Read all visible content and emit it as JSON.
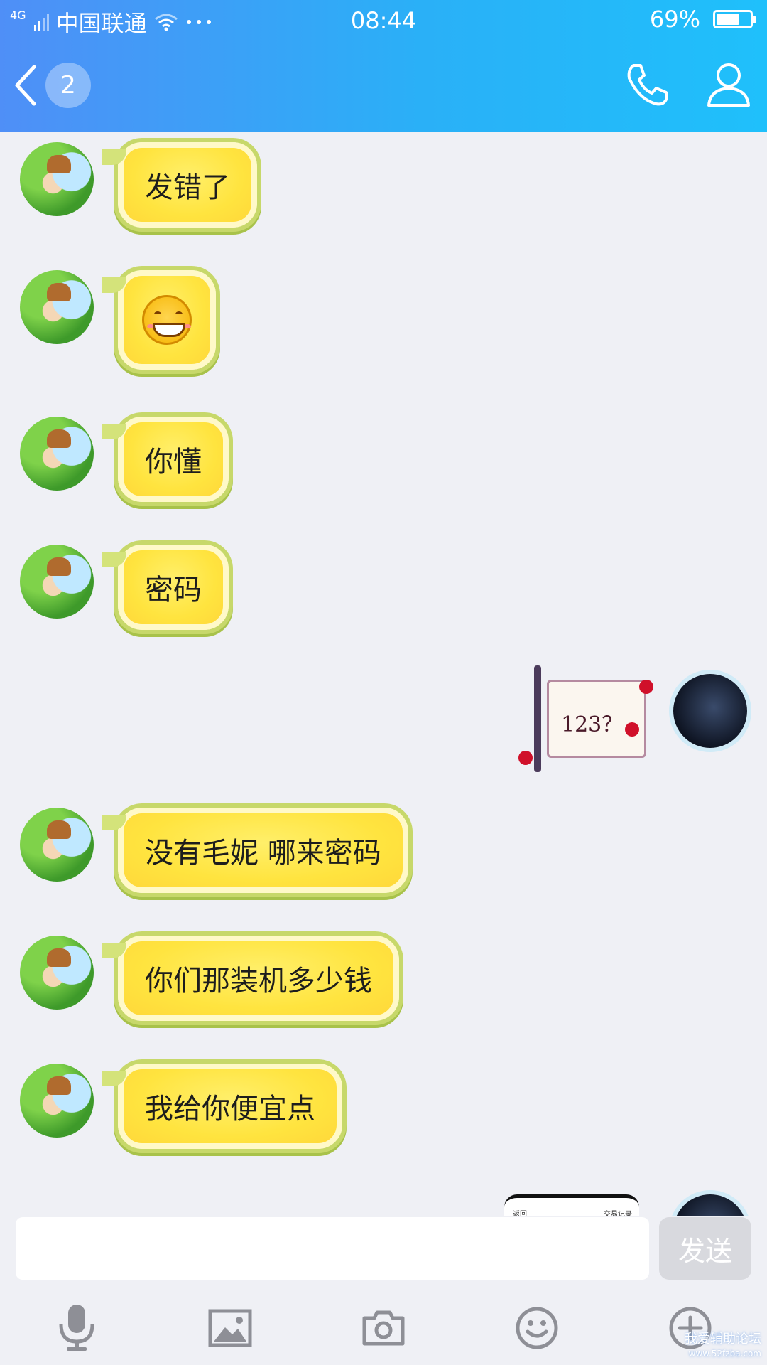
{
  "status_bar": {
    "network": "4G",
    "carrier": "中国联通",
    "time": "08:44",
    "battery_percent": "69%",
    "battery_level": 0.69
  },
  "nav": {
    "unread_count": "2"
  },
  "messages": [
    {
      "side": "left",
      "type": "text",
      "text": "发错了"
    },
    {
      "side": "left",
      "type": "emoji",
      "emoji": "grin-emoji"
    },
    {
      "side": "left",
      "type": "text",
      "text": "你懂"
    },
    {
      "side": "left",
      "type": "text",
      "text": "密码"
    },
    {
      "side": "right",
      "type": "sticker",
      "text": "123？"
    },
    {
      "side": "left",
      "type": "text",
      "text": "没有毛妮   哪来密码"
    },
    {
      "side": "left",
      "type": "text",
      "text": "你们那装机多少钱"
    },
    {
      "side": "left",
      "type": "text",
      "text": "我给你便宜点"
    },
    {
      "side": "right",
      "type": "image",
      "text_left": "返回",
      "text_right": "交易记录"
    }
  ],
  "composer": {
    "input_value": "",
    "send_label": "发送"
  },
  "toolbar": {
    "icons": [
      "microphone-icon",
      "image-icon",
      "camera-icon",
      "emoji-icon",
      "plus-icon"
    ]
  },
  "watermark": {
    "title": "我爱辅助论坛",
    "url": "www.52fzba.com"
  },
  "colors": {
    "header_start": "#4f8ff7",
    "header_end": "#1fc0fb",
    "bubble_yellow": "#ffe43f",
    "bubble_border": "#c7d86a",
    "background": "#eff0f5"
  }
}
